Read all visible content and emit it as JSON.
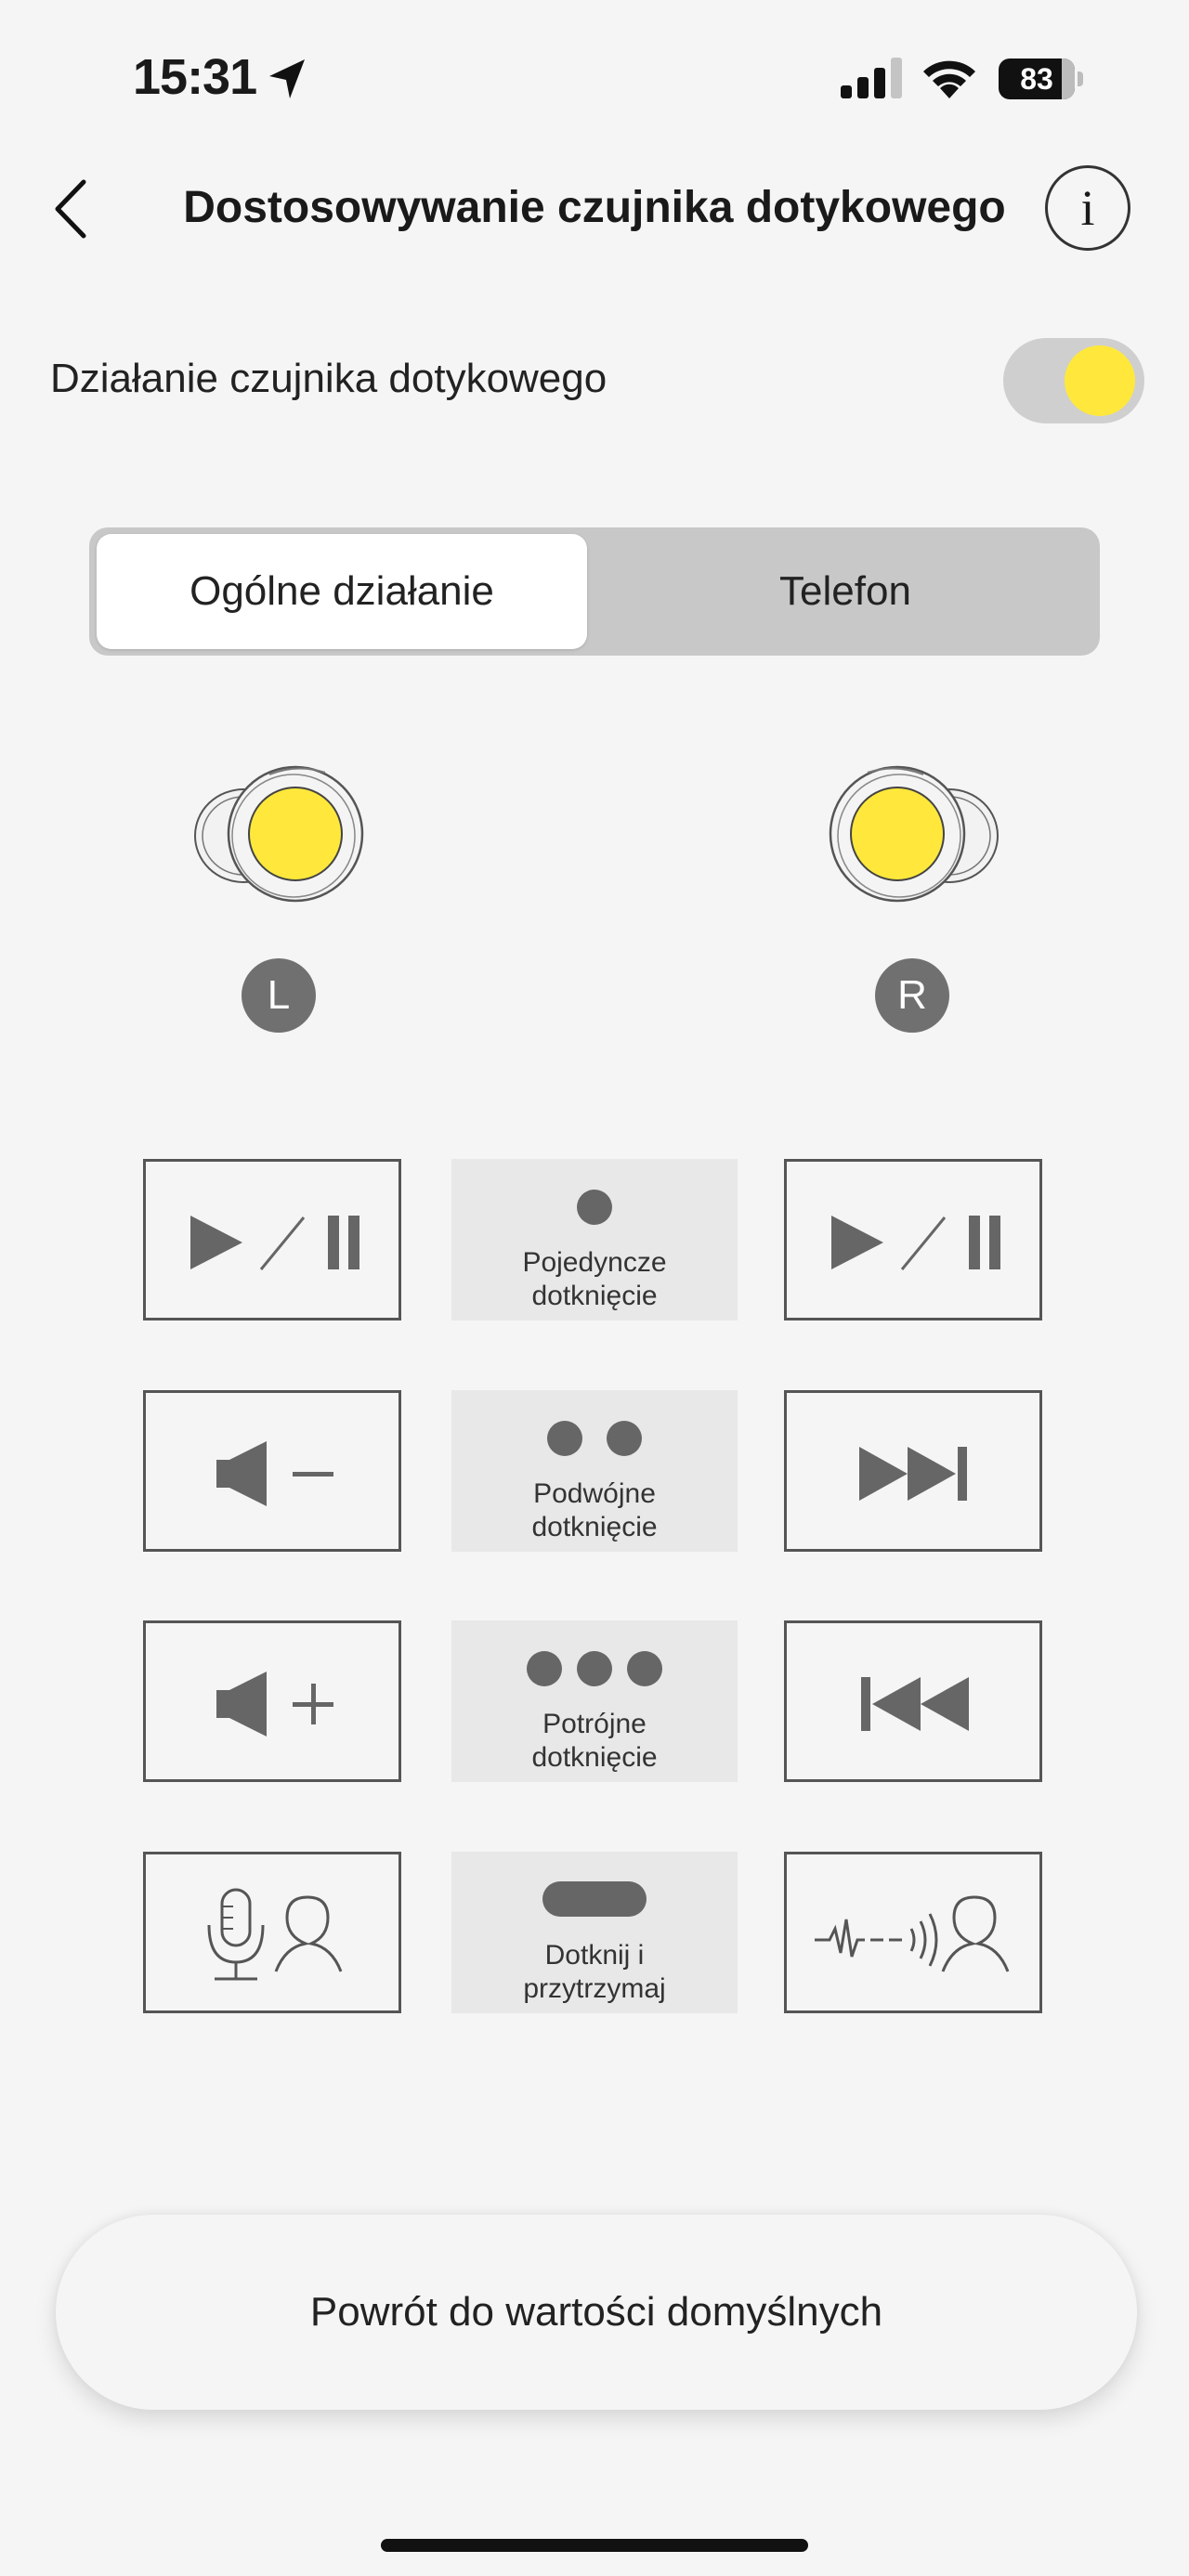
{
  "status_bar": {
    "time": "15:31",
    "battery_level": "83"
  },
  "header": {
    "title": "Dostosowywanie czujnika dotykowego",
    "back_icon": "chevron-left-icon",
    "info_label": "i"
  },
  "touch_sensor": {
    "label": "Działanie czujnika dotykowego",
    "enabled": true,
    "accent": "#ffe83b"
  },
  "tabs": [
    {
      "label": "Ogólne działanie",
      "selected": true
    },
    {
      "label": "Telefon",
      "selected": false
    }
  ],
  "earbuds": {
    "left_label": "L",
    "right_label": "R"
  },
  "gestures": [
    {
      "label": "Pojedyncze\ndotknięcie",
      "left_action": "play-pause-icon",
      "right_action": "play-pause-icon"
    },
    {
      "label": "Podwójne\ndotknięcie",
      "left_action": "volume-down-icon",
      "right_action": "next-track-icon"
    },
    {
      "label": "Potrójne\ndotknięcie",
      "left_action": "volume-up-icon",
      "right_action": "previous-track-icon"
    },
    {
      "label": "Dotknij i\nprzytrzymaj",
      "left_action": "voice-assistant-icon",
      "right_action": "ambient-sound-icon"
    }
  ],
  "reset_button": {
    "label": "Powrót do wartości domyślnych"
  }
}
